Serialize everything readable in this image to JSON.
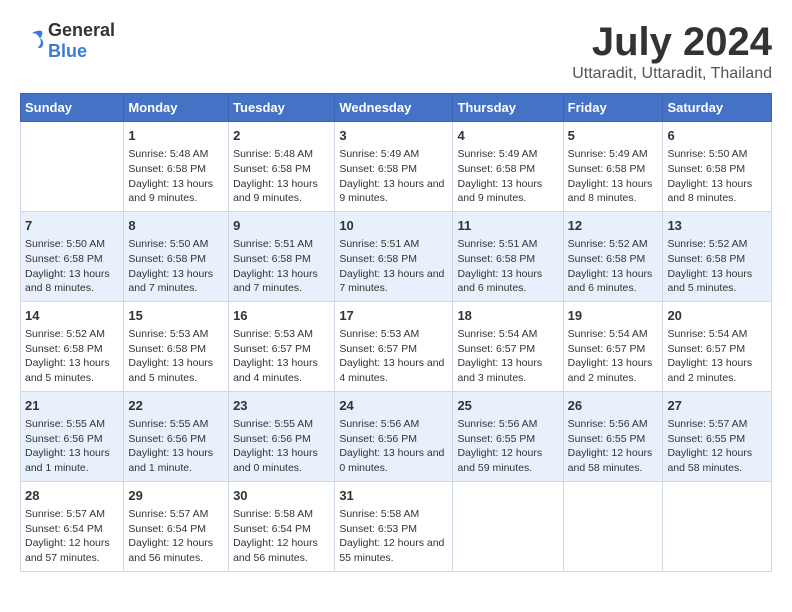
{
  "logo": {
    "general": "General",
    "blue": "Blue"
  },
  "title": "July 2024",
  "subtitle": "Uttaradit, Uttaradit, Thailand",
  "days_of_week": [
    "Sunday",
    "Monday",
    "Tuesday",
    "Wednesday",
    "Thursday",
    "Friday",
    "Saturday"
  ],
  "weeks": [
    [
      {
        "day": "",
        "info": ""
      },
      {
        "day": "1",
        "info": "Sunrise: 5:48 AM\nSunset: 6:58 PM\nDaylight: 13 hours and 9 minutes."
      },
      {
        "day": "2",
        "info": "Sunrise: 5:48 AM\nSunset: 6:58 PM\nDaylight: 13 hours and 9 minutes."
      },
      {
        "day": "3",
        "info": "Sunrise: 5:49 AM\nSunset: 6:58 PM\nDaylight: 13 hours and 9 minutes."
      },
      {
        "day": "4",
        "info": "Sunrise: 5:49 AM\nSunset: 6:58 PM\nDaylight: 13 hours and 9 minutes."
      },
      {
        "day": "5",
        "info": "Sunrise: 5:49 AM\nSunset: 6:58 PM\nDaylight: 13 hours and 8 minutes."
      },
      {
        "day": "6",
        "info": "Sunrise: 5:50 AM\nSunset: 6:58 PM\nDaylight: 13 hours and 8 minutes."
      }
    ],
    [
      {
        "day": "7",
        "info": "Sunrise: 5:50 AM\nSunset: 6:58 PM\nDaylight: 13 hours and 8 minutes."
      },
      {
        "day": "8",
        "info": "Sunrise: 5:50 AM\nSunset: 6:58 PM\nDaylight: 13 hours and 7 minutes."
      },
      {
        "day": "9",
        "info": "Sunrise: 5:51 AM\nSunset: 6:58 PM\nDaylight: 13 hours and 7 minutes."
      },
      {
        "day": "10",
        "info": "Sunrise: 5:51 AM\nSunset: 6:58 PM\nDaylight: 13 hours and 7 minutes."
      },
      {
        "day": "11",
        "info": "Sunrise: 5:51 AM\nSunset: 6:58 PM\nDaylight: 13 hours and 6 minutes."
      },
      {
        "day": "12",
        "info": "Sunrise: 5:52 AM\nSunset: 6:58 PM\nDaylight: 13 hours and 6 minutes."
      },
      {
        "day": "13",
        "info": "Sunrise: 5:52 AM\nSunset: 6:58 PM\nDaylight: 13 hours and 5 minutes."
      }
    ],
    [
      {
        "day": "14",
        "info": "Sunrise: 5:52 AM\nSunset: 6:58 PM\nDaylight: 13 hours and 5 minutes."
      },
      {
        "day": "15",
        "info": "Sunrise: 5:53 AM\nSunset: 6:58 PM\nDaylight: 13 hours and 5 minutes."
      },
      {
        "day": "16",
        "info": "Sunrise: 5:53 AM\nSunset: 6:57 PM\nDaylight: 13 hours and 4 minutes."
      },
      {
        "day": "17",
        "info": "Sunrise: 5:53 AM\nSunset: 6:57 PM\nDaylight: 13 hours and 4 minutes."
      },
      {
        "day": "18",
        "info": "Sunrise: 5:54 AM\nSunset: 6:57 PM\nDaylight: 13 hours and 3 minutes."
      },
      {
        "day": "19",
        "info": "Sunrise: 5:54 AM\nSunset: 6:57 PM\nDaylight: 13 hours and 2 minutes."
      },
      {
        "day": "20",
        "info": "Sunrise: 5:54 AM\nSunset: 6:57 PM\nDaylight: 13 hours and 2 minutes."
      }
    ],
    [
      {
        "day": "21",
        "info": "Sunrise: 5:55 AM\nSunset: 6:56 PM\nDaylight: 13 hours and 1 minute."
      },
      {
        "day": "22",
        "info": "Sunrise: 5:55 AM\nSunset: 6:56 PM\nDaylight: 13 hours and 1 minute."
      },
      {
        "day": "23",
        "info": "Sunrise: 5:55 AM\nSunset: 6:56 PM\nDaylight: 13 hours and 0 minutes."
      },
      {
        "day": "24",
        "info": "Sunrise: 5:56 AM\nSunset: 6:56 PM\nDaylight: 13 hours and 0 minutes."
      },
      {
        "day": "25",
        "info": "Sunrise: 5:56 AM\nSunset: 6:55 PM\nDaylight: 12 hours and 59 minutes."
      },
      {
        "day": "26",
        "info": "Sunrise: 5:56 AM\nSunset: 6:55 PM\nDaylight: 12 hours and 58 minutes."
      },
      {
        "day": "27",
        "info": "Sunrise: 5:57 AM\nSunset: 6:55 PM\nDaylight: 12 hours and 58 minutes."
      }
    ],
    [
      {
        "day": "28",
        "info": "Sunrise: 5:57 AM\nSunset: 6:54 PM\nDaylight: 12 hours and 57 minutes."
      },
      {
        "day": "29",
        "info": "Sunrise: 5:57 AM\nSunset: 6:54 PM\nDaylight: 12 hours and 56 minutes."
      },
      {
        "day": "30",
        "info": "Sunrise: 5:58 AM\nSunset: 6:54 PM\nDaylight: 12 hours and 56 minutes."
      },
      {
        "day": "31",
        "info": "Sunrise: 5:58 AM\nSunset: 6:53 PM\nDaylight: 12 hours and 55 minutes."
      },
      {
        "day": "",
        "info": ""
      },
      {
        "day": "",
        "info": ""
      },
      {
        "day": "",
        "info": ""
      }
    ]
  ]
}
